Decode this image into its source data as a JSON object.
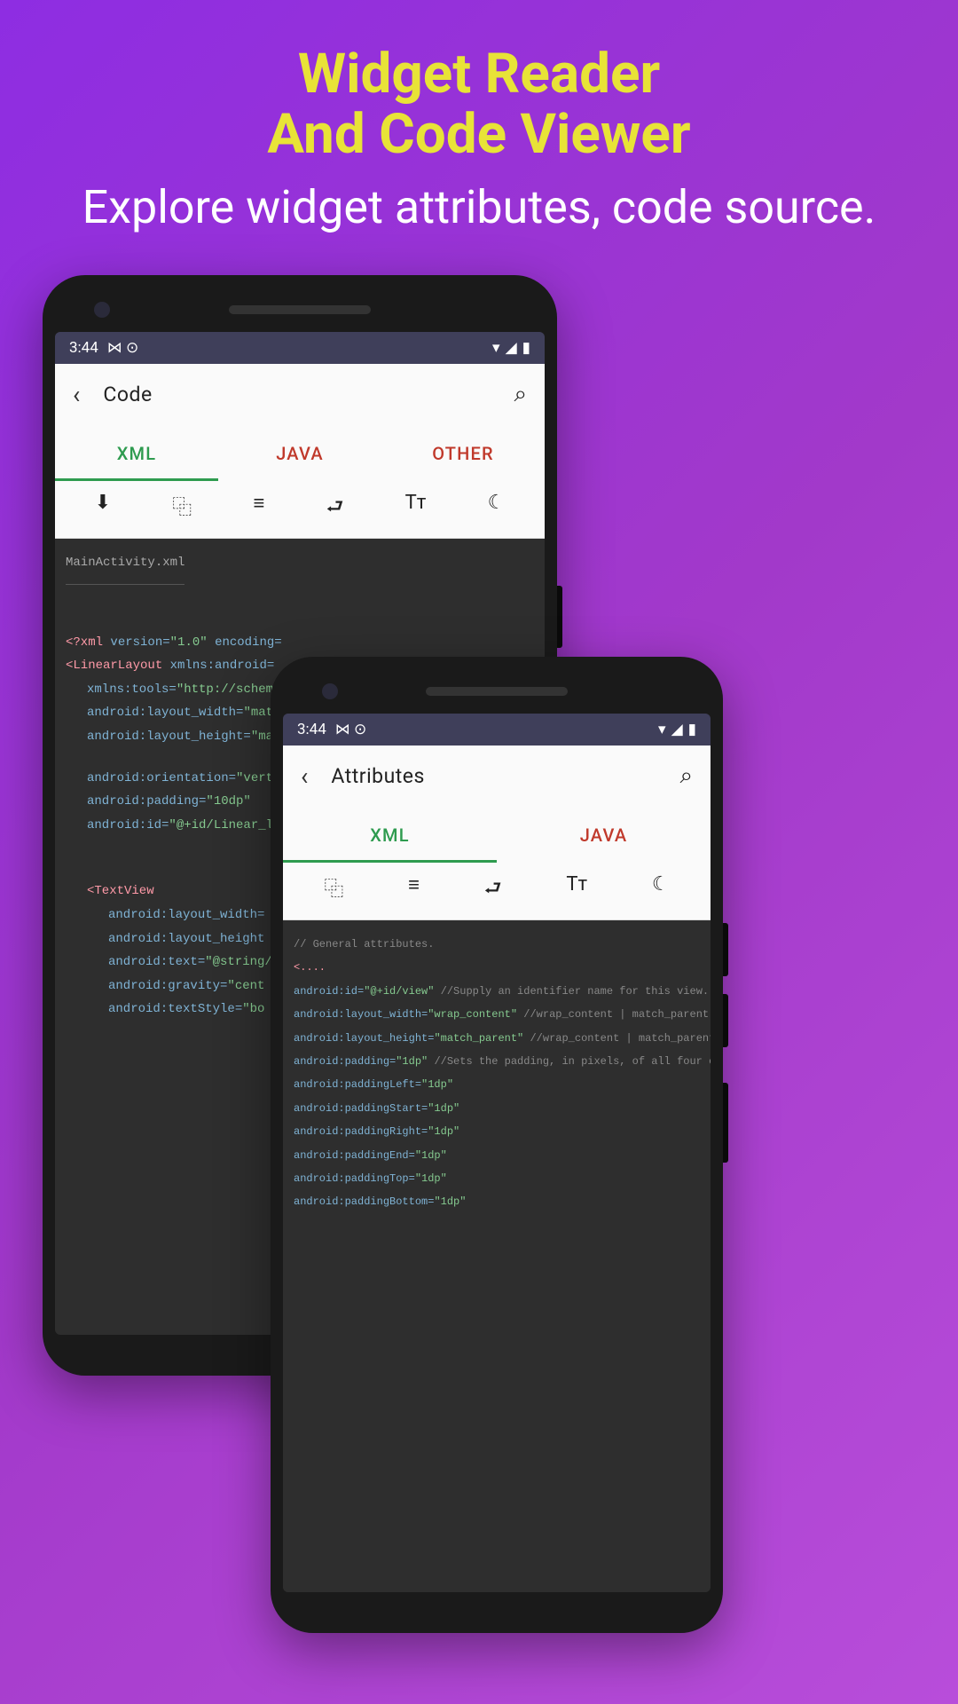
{
  "hero": {
    "title_line1": "Widget Reader",
    "title_line2": "And Code Viewer",
    "subtitle": "Explore widget attributes, code source."
  },
  "status": {
    "time": "3:44",
    "icons": "⋈ ⊙",
    "right": "▾◢ ▮"
  },
  "phone1": {
    "app_title": "Code",
    "tabs": {
      "xml": "XML",
      "java": "JAVA",
      "other": "OTHER"
    },
    "filename": "MainActivity.xml",
    "code": {
      "l1a": "<?xml ",
      "l1b": "version=",
      "l1c": "\"1.0\" ",
      "l1d": "encoding=",
      "l2a": "<LinearLayout ",
      "l2b": "xmlns:android=",
      "l3a": "xmlns:tools=",
      "l3b": "\"http://schem",
      "l4a": "android:layout_width=",
      "l4b": "\"mat",
      "l5a": "android:layout_height=",
      "l5b": "\"ma",
      "l6a": "android:orientation=",
      "l6b": "\"vert",
      "l7a": "android:padding=",
      "l7b": "\"10dp\"",
      "l8a": "android:id=",
      "l8b": "\"@+id/Linear_l",
      "l9a": "<TextView",
      "l10a": "android:layout_width=",
      "l11a": "android:layout_height",
      "l12a": "android:text=",
      "l12b": "\"@string/",
      "l13a": "android:gravity=",
      "l13b": "\"cent",
      "l14a": "android:textStyle=",
      "l14b": "\"bo"
    }
  },
  "phone2": {
    "app_title": "Attributes",
    "tabs": {
      "xml": "XML",
      "java": "JAVA"
    },
    "code": {
      "c1": "// General  attributes.",
      "c2": "<....",
      "l1a": "android:id=",
      "l1b": "\"@+id/view\" ",
      "l1c": "//Supply an identifier name for this view.",
      "l2a": "android:layout_width=",
      "l2b": "\"wrap_content\" ",
      "l2c": "//wrap_content | match_parent |",
      "l3a": "android:layout_height=",
      "l3b": "\"match_parent\" ",
      "l3c": "//wrap_content | match_parent",
      "l4a": "android:padding=",
      "l4b": "\"1dp\" ",
      "l4c": "//Sets the padding, in pixels, of all four ed",
      "l5a": "android:paddingLeft=",
      "l5b": "\"1dp\"",
      "l6a": "android:paddingStart=",
      "l6b": "\"1dp\"",
      "l7a": "android:paddingRight=",
      "l7b": "\"1dp\"",
      "l8a": "android:paddingEnd=",
      "l8b": "\"1dp\"",
      "l9a": "android:paddingTop=",
      "l9b": "\"1dp\"",
      "l10a": "android:paddingBottom=",
      "l10b": "\"1dp\""
    }
  },
  "icons": {
    "download": "⬇",
    "copy": "⿻",
    "menu": "≡",
    "wrap": "⮐",
    "text": "Tт",
    "dark": "☾"
  }
}
